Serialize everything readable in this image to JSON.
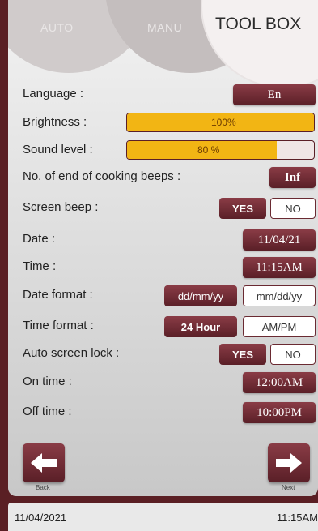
{
  "tabs": {
    "auto": "AUTO",
    "manu": "MANU",
    "toolbox": "TOOL BOX"
  },
  "settings": {
    "language": {
      "label": "Language :",
      "value": "En"
    },
    "brightness": {
      "label": "Brightness :",
      "text": "100%",
      "level_percent": 100
    },
    "sound": {
      "label": "Sound level :",
      "text": "80 %",
      "level_percent": 80
    },
    "beeps": {
      "label": "No. of end of cooking beeps :",
      "value": "Inf"
    },
    "screen_beep": {
      "label": "Screen beep :",
      "yes": "YES",
      "no": "NO",
      "selected": "YES"
    },
    "date": {
      "label": "Date :",
      "value": "11/04/21"
    },
    "time": {
      "label": "Time :",
      "value": "11:15AM"
    },
    "date_format": {
      "label": "Date format :",
      "opt1": "dd/mm/yy",
      "opt2": "mm/dd/yy",
      "selected": "dd/mm/yy"
    },
    "time_format": {
      "label": "Time format :",
      "opt1": "24 Hour",
      "opt2": "AM/PM",
      "selected": "24 Hour"
    },
    "auto_lock": {
      "label": "Auto screen lock :",
      "yes": "YES",
      "no": "NO",
      "selected": "YES"
    },
    "on_time": {
      "label": "On time :",
      "value": "12:00AM"
    },
    "off_time": {
      "label": "Off time :",
      "value": "10:00PM"
    }
  },
  "nav": {
    "back": "Back",
    "next": "Next"
  },
  "footer": {
    "date": "11/04/2021",
    "time": "11:15AM"
  },
  "colors": {
    "accent": "#6a2a32",
    "level_fill": "#f2b514",
    "frame": "#5a1f24"
  }
}
